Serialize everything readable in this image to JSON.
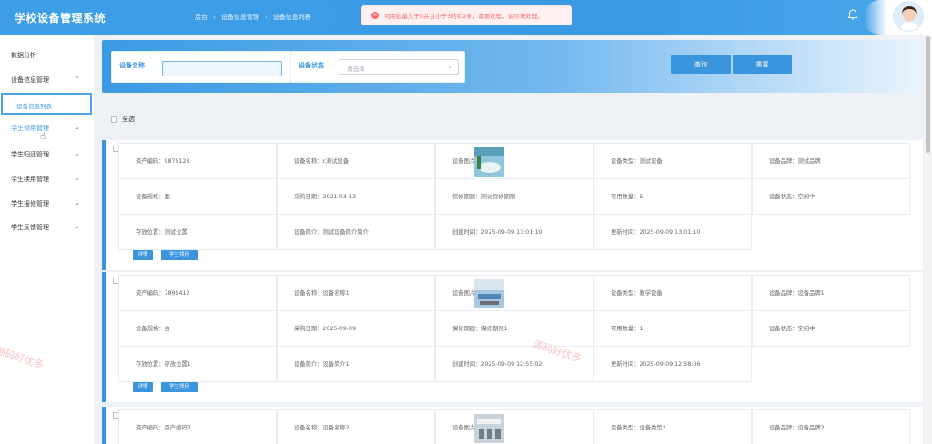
{
  "header": {
    "app_title": "学校设备管理系统",
    "breadcrumb": [
      "后台",
      "设备信息管理",
      "设备信息列表"
    ],
    "alert_text": "可用数量大于0并且小于3的有2条，需要处理，请尽快处理。"
  },
  "sidebar": {
    "items": [
      {
        "label": "数据分析",
        "chev": ""
      },
      {
        "label": "设备信息管理",
        "chev": "⌃"
      },
      {
        "label": "学生领用管理",
        "chev": "⌄"
      },
      {
        "label": "学生归还管理",
        "chev": "⌄"
      },
      {
        "label": "学生续用管理",
        "chev": "⌄"
      },
      {
        "label": "学生报修管理",
        "chev": "⌄"
      },
      {
        "label": "学生反馈管理",
        "chev": "⌄"
      }
    ],
    "sub_active": "设备信息列表"
  },
  "search": {
    "name_label": "设备名称",
    "status_label": "设备状态",
    "status_placeholder": "请选择",
    "query_button": "查询",
    "reset_button": "重置"
  },
  "select_all": "全选",
  "cards": [
    {
      "row1": [
        [
          "资产编码：",
          "9875123"
        ],
        [
          "设备名称：",
          "c测试设备"
        ],
        [
          "设备图片：",
          ""
        ],
        [
          "设备类型：",
          "测试设备"
        ],
        [
          "设备品牌：",
          "测试品牌"
        ]
      ],
      "row2": [
        [
          "设备规格：",
          "套"
        ],
        [
          "采购日期：",
          "2021-03-13"
        ],
        [
          "保修期限：",
          "测试保修期限"
        ],
        [
          "可用数量：",
          "5"
        ],
        [
          "设备状态：",
          "空闲中"
        ]
      ],
      "row3": [
        [
          "存放位置：",
          "测试位置"
        ],
        [
          "设备简介：",
          "测试设备简介简介"
        ],
        [
          "创建时间：",
          "2025-09-09 13:01:10"
        ],
        [
          "更新时间：",
          "2025-09-09 13:01:10"
        ]
      ],
      "buttons": [
        "详情",
        "学生领用"
      ]
    },
    {
      "row1": [
        [
          "资产编码：",
          "7895412"
        ],
        [
          "设备名称：",
          "设备名称1"
        ],
        [
          "设备图片：",
          ""
        ],
        [
          "设备类型：",
          "教学设备"
        ],
        [
          "设备品牌：",
          "设备品牌1"
        ]
      ],
      "row2": [
        [
          "设备规格：",
          "台"
        ],
        [
          "采购日期：",
          "2025-09-09"
        ],
        [
          "保修期限：",
          "保修期限1"
        ],
        [
          "可用数量：",
          "1"
        ],
        [
          "设备状态：",
          "空闲中"
        ]
      ],
      "row3": [
        [
          "存放位置：",
          "存放位置1"
        ],
        [
          "设备简介：",
          "设备简介1"
        ],
        [
          "创建时间：",
          "2025-09-09 12:55:02"
        ],
        [
          "更新时间：",
          "2025-09-09 12:58:06"
        ]
      ],
      "buttons": [
        "详情",
        "学生领用"
      ]
    },
    {
      "row1": [
        [
          "资产编码：",
          "资产编码2"
        ],
        [
          "设备名称：",
          "设备名称2"
        ],
        [
          "设备图片：",
          ""
        ],
        [
          "设备类型：",
          "设备类型2"
        ],
        [
          "设备品牌：",
          "设备品牌2"
        ]
      ]
    }
  ],
  "watermark": "源码好优多",
  "colors": {
    "primary": "#3a94de",
    "alert_text": "#f56c6c",
    "alert_bg": "#fef0f0"
  }
}
